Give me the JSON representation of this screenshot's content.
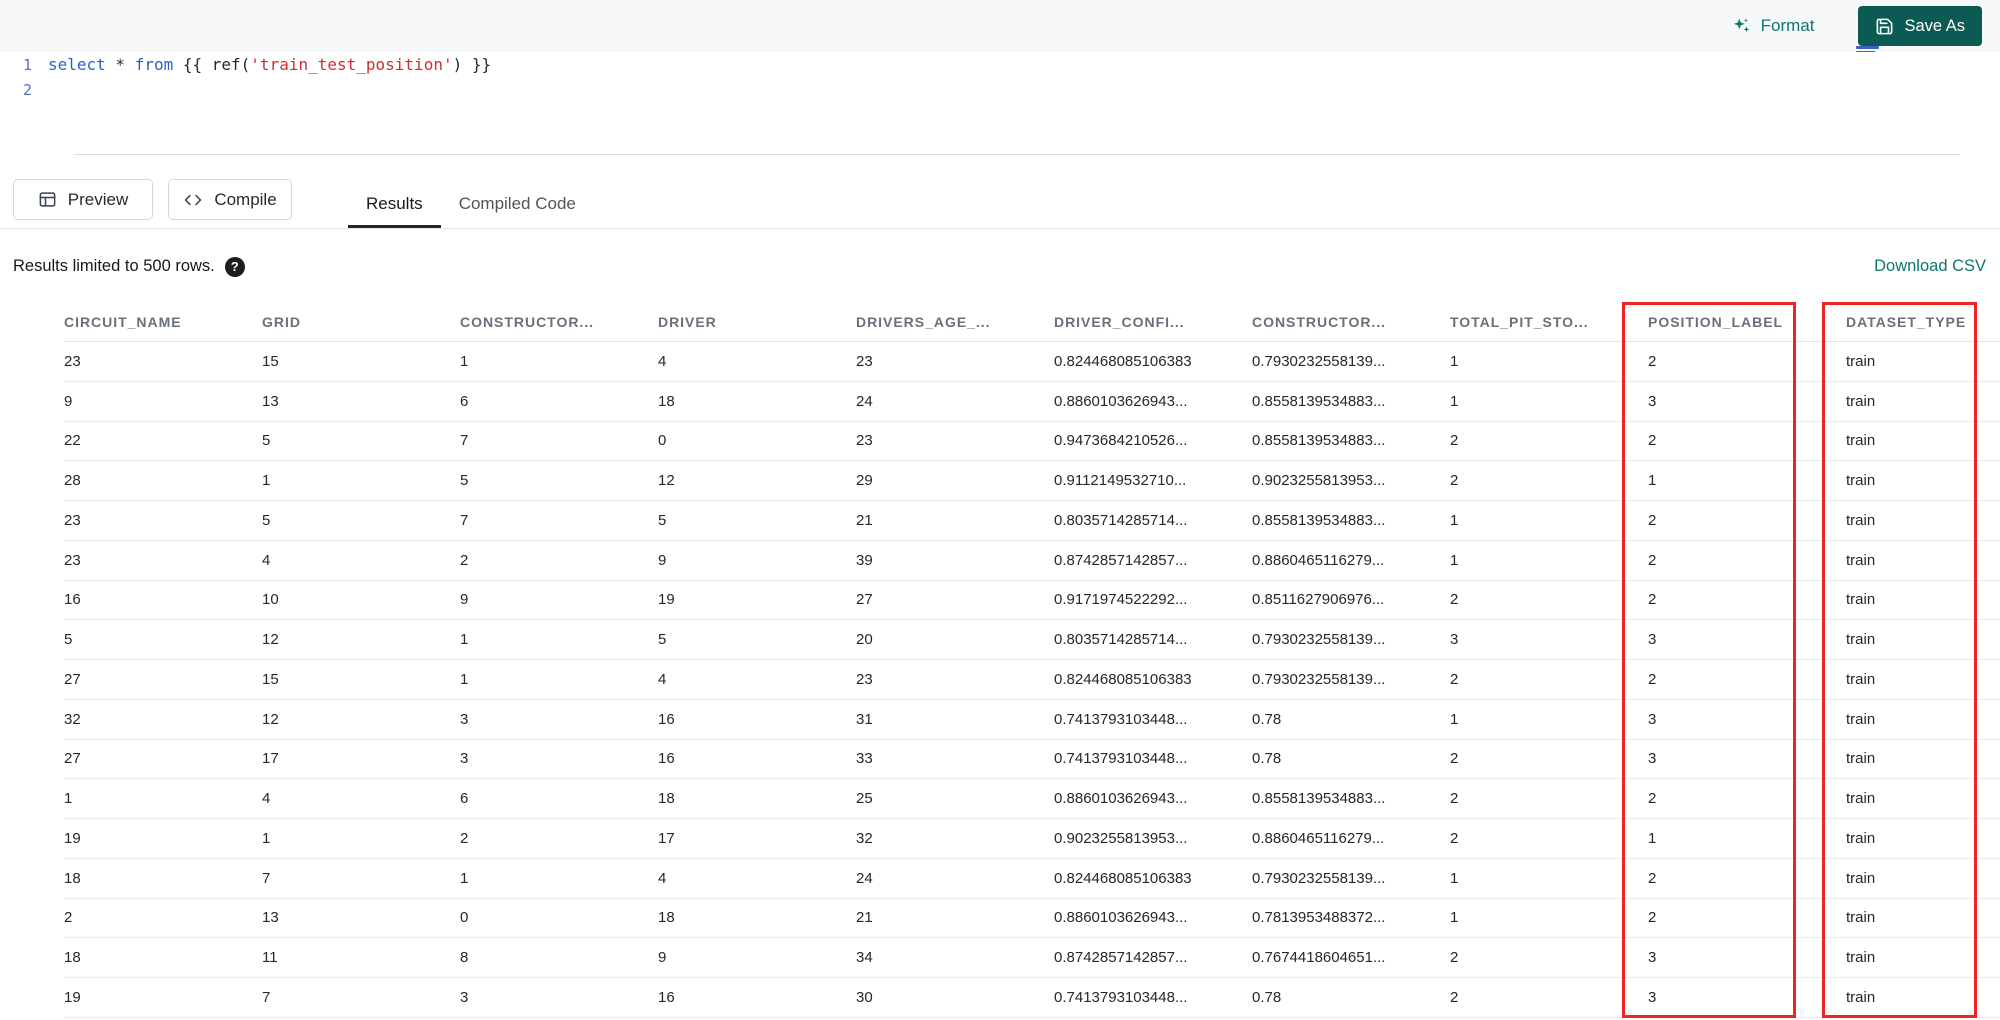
{
  "toolbar": {
    "format": "Format",
    "save_as": "Save As"
  },
  "editor": {
    "line1_number": "1",
    "line2_number": "2",
    "tokens": [
      {
        "t": "select",
        "c": "keyword"
      },
      {
        "t": " * ",
        "c": "plain"
      },
      {
        "t": "from",
        "c": "keyword"
      },
      {
        "t": " {{ ",
        "c": "plain"
      },
      {
        "t": "ref(",
        "c": "plain"
      },
      {
        "t": "'train_test_position'",
        "c": "string"
      },
      {
        "t": ") }}",
        "c": "plain"
      }
    ]
  },
  "actions": {
    "preview": "Preview",
    "compile": "Compile"
  },
  "tabs": {
    "results": "Results",
    "compiled_code": "Compiled Code"
  },
  "results_bar": {
    "limit_text": "Results limited to 500 rows.",
    "help_glyph": "?",
    "download": "Download CSV"
  },
  "table": {
    "columns": [
      "CIRCUIT_NAME",
      "GRID",
      "CONSTRUCTOR...",
      "DRIVER",
      "DRIVERS_AGE_...",
      "DRIVER_CONFI...",
      "CONSTRUCTOR...",
      "TOTAL_PIT_STO...",
      "POSITION_LABEL",
      "DATASET_TYPE"
    ],
    "highlighted_columns": [
      "POSITION_LABEL",
      "DATASET_TYPE"
    ],
    "rows": [
      [
        "23",
        "15",
        "1",
        "4",
        "23",
        "0.824468085106383",
        "0.7930232558139...",
        "1",
        "2",
        "train"
      ],
      [
        "9",
        "13",
        "6",
        "18",
        "24",
        "0.8860103626943...",
        "0.8558139534883...",
        "1",
        "3",
        "train"
      ],
      [
        "22",
        "5",
        "7",
        "0",
        "23",
        "0.9473684210526...",
        "0.8558139534883...",
        "2",
        "2",
        "train"
      ],
      [
        "28",
        "1",
        "5",
        "12",
        "29",
        "0.9112149532710...",
        "0.9023255813953...",
        "2",
        "1",
        "train"
      ],
      [
        "23",
        "5",
        "7",
        "5",
        "21",
        "0.8035714285714...",
        "0.8558139534883...",
        "1",
        "2",
        "train"
      ],
      [
        "23",
        "4",
        "2",
        "9",
        "39",
        "0.8742857142857...",
        "0.8860465116279...",
        "1",
        "2",
        "train"
      ],
      [
        "16",
        "10",
        "9",
        "19",
        "27",
        "0.9171974522292...",
        "0.8511627906976...",
        "2",
        "2",
        "train"
      ],
      [
        "5",
        "12",
        "1",
        "5",
        "20",
        "0.8035714285714...",
        "0.7930232558139...",
        "3",
        "3",
        "train"
      ],
      [
        "27",
        "15",
        "1",
        "4",
        "23",
        "0.824468085106383",
        "0.7930232558139...",
        "2",
        "2",
        "train"
      ],
      [
        "32",
        "12",
        "3",
        "16",
        "31",
        "0.7413793103448...",
        "0.78",
        "1",
        "3",
        "train"
      ],
      [
        "27",
        "17",
        "3",
        "16",
        "33",
        "0.7413793103448...",
        "0.78",
        "2",
        "3",
        "train"
      ],
      [
        "1",
        "4",
        "6",
        "18",
        "25",
        "0.8860103626943...",
        "0.8558139534883...",
        "2",
        "2",
        "train"
      ],
      [
        "19",
        "1",
        "2",
        "17",
        "32",
        "0.9023255813953...",
        "0.8860465116279...",
        "2",
        "1",
        "train"
      ],
      [
        "18",
        "7",
        "1",
        "4",
        "24",
        "0.824468085106383",
        "0.7930232558139...",
        "1",
        "2",
        "train"
      ],
      [
        "2",
        "13",
        "0",
        "18",
        "21",
        "0.8860103626943...",
        "0.7813953488372...",
        "1",
        "2",
        "train"
      ],
      [
        "18",
        "11",
        "8",
        "9",
        "34",
        "0.8742857142857...",
        "0.7674418604651...",
        "2",
        "3",
        "train"
      ],
      [
        "19",
        "7",
        "3",
        "16",
        "30",
        "0.7413793103448...",
        "0.78",
        "2",
        "3",
        "train"
      ]
    ]
  },
  "colors": {
    "accent_teal": "#0f766e",
    "save_button_bg": "#0b5b54",
    "annotation_red": "#ee2424"
  }
}
